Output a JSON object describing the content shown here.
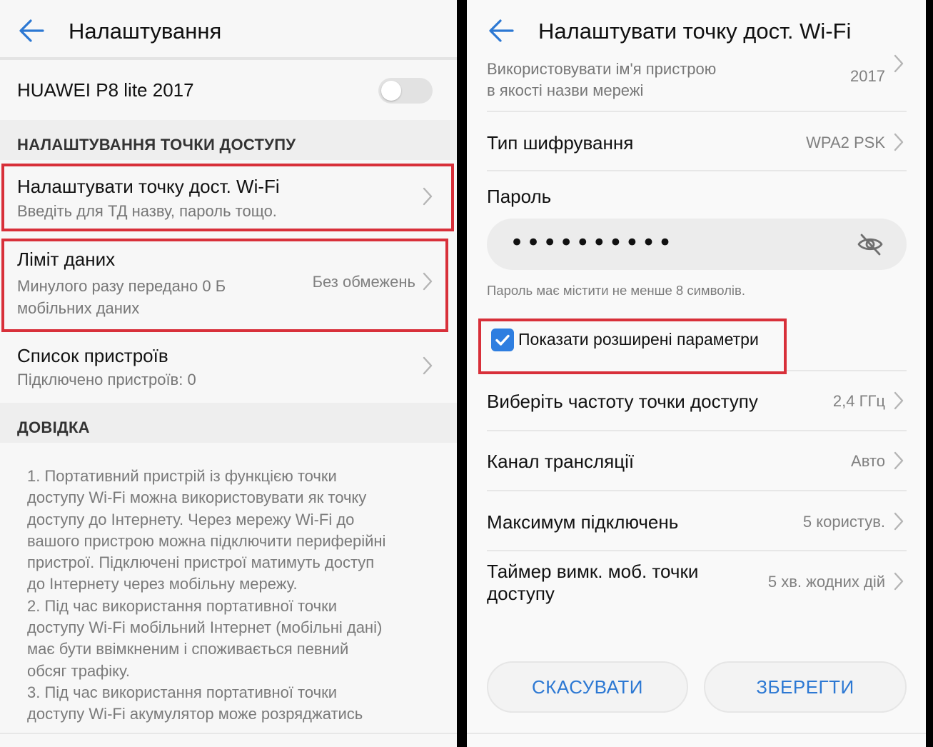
{
  "colors": {
    "accent": "#2c78d3",
    "highlight": "#d8303a"
  },
  "left": {
    "title": "Налаштування",
    "back_icon": "arrow-left-icon",
    "device": {
      "name": "HUAWEI P8 lite 2017",
      "toggle_on": false
    },
    "section_hotspot": "НАЛАШТУВАННЯ ТОЧКИ ДОСТУПУ",
    "items": [
      {
        "title": "Налаштувати точку дост. Wi-Fi",
        "subtitle": "Введіть для ТД назву, пароль тощо."
      },
      {
        "title": "Ліміт даних",
        "subtitle_line1": "Минулого разу передано 0 Б",
        "subtitle_line2": "мобільних даних",
        "value": "Без обмежень"
      },
      {
        "title": "Список пристроїв",
        "subtitle": "Підключено пристроїв: 0"
      }
    ],
    "section_help": "ДОВІДКА",
    "help_lines": [
      "1. Портативний пристрій із функцією точки",
      "доступу Wi-Fi можна використовувати як точку",
      "доступу до Інтернету. Через мережу Wi-Fi до",
      "вашого пристрою можна підключити периферійні",
      "пристрої. Підключені пристрої матимуть доступ",
      "до Інтернету через мобільну мережу.",
      "2. Під час використання портативної точки",
      "доступу Wi-Fi мобільний Інтернет (мобільні дані)",
      "має бути ввімкненим і споживається певний",
      "обсяг трафіку.",
      "3. Під час використання портативної точки",
      "доступу Wi-Fi акумулятор може розряджатись"
    ]
  },
  "right": {
    "title": "Налаштувати точку дост. Wi-Fi",
    "back_icon": "arrow-left-icon",
    "network_name": {
      "line1": "Використовувати ім'я пристрою",
      "line2": "в якості назви мережі",
      "value": "2017"
    },
    "encryption": {
      "label": "Тип шифрування",
      "value": "WPA2 PSK"
    },
    "password": {
      "label": "Пароль",
      "value": "••••••••••",
      "hint": "Пароль має містити не менше 8 символів.",
      "visibility_icon": "eye-off-icon"
    },
    "advanced": {
      "label": "Показати розширені параметри",
      "checked": true
    },
    "settings": [
      {
        "label": "Виберіть частоту точки доступу",
        "value": "2,4 ГГц"
      },
      {
        "label": "Канал трансляції",
        "value": "Авто"
      },
      {
        "label": "Максимум підключень",
        "value": "5 користув."
      },
      {
        "label_line1": "Таймер вимк. моб. точки",
        "label_line2": "доступу",
        "value": "5 хв. жодних дій"
      }
    ],
    "buttons": {
      "cancel": "СКАСУВАТИ",
      "save": "ЗБЕРЕГТИ"
    }
  }
}
